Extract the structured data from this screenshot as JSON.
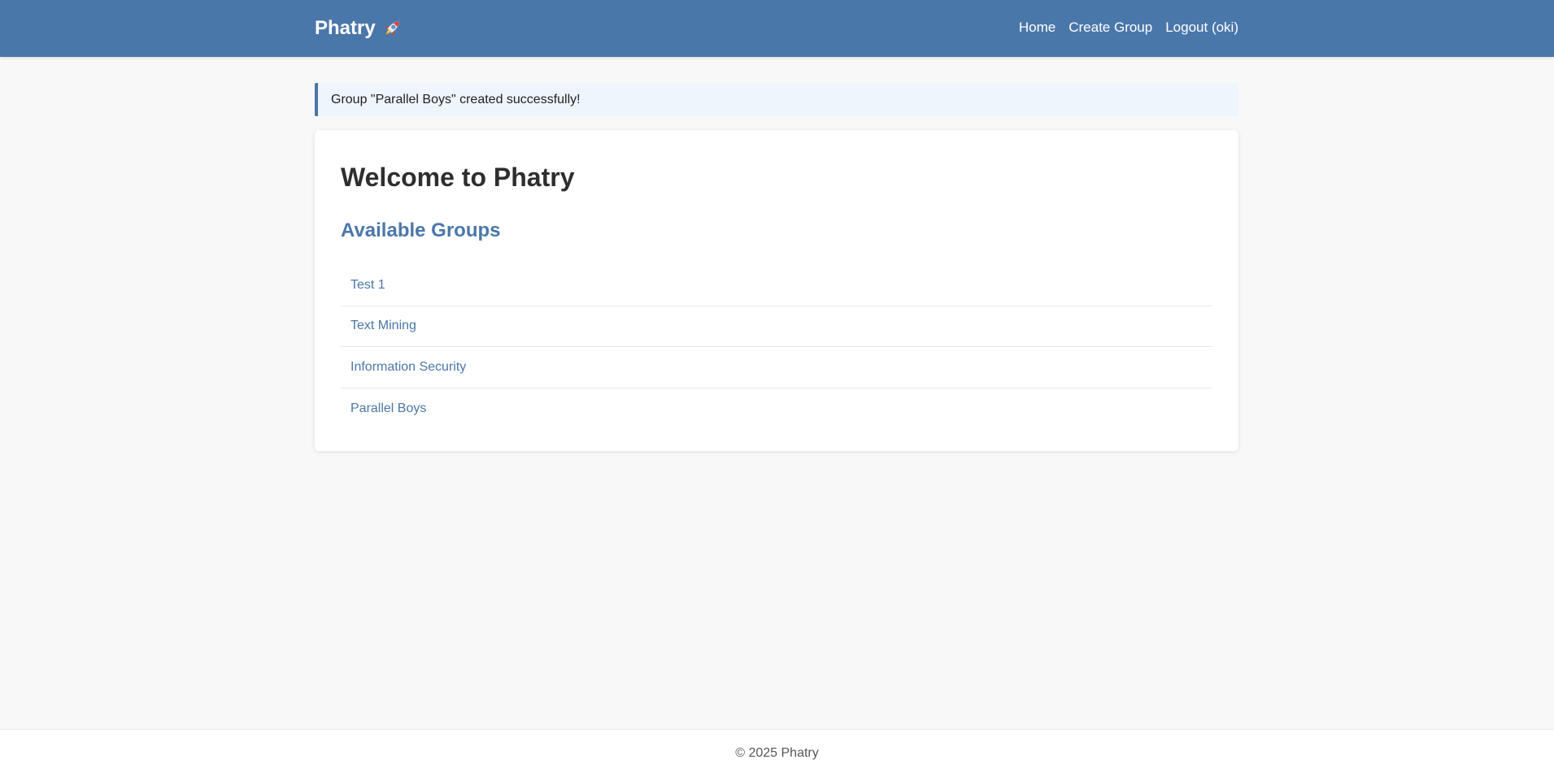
{
  "header": {
    "brand": "Phatry",
    "brand_icon": "rocket-icon",
    "nav": {
      "home": "Home",
      "create_group": "Create Group",
      "logout": "Logout (oki)"
    }
  },
  "alert": {
    "message": "Group \"Parallel Boys\" created successfully!"
  },
  "main": {
    "title": "Welcome to Phatry",
    "groups_heading": "Available Groups",
    "groups": [
      {
        "name": "Test 1"
      },
      {
        "name": "Text Mining"
      },
      {
        "name": "Information Security"
      },
      {
        "name": "Parallel Boys"
      }
    ]
  },
  "footer": {
    "text": "© 2025 Phatry"
  },
  "colors": {
    "primary": "#4a77aa",
    "background": "#f8f8f8",
    "alert_background": "#eef5fd"
  }
}
